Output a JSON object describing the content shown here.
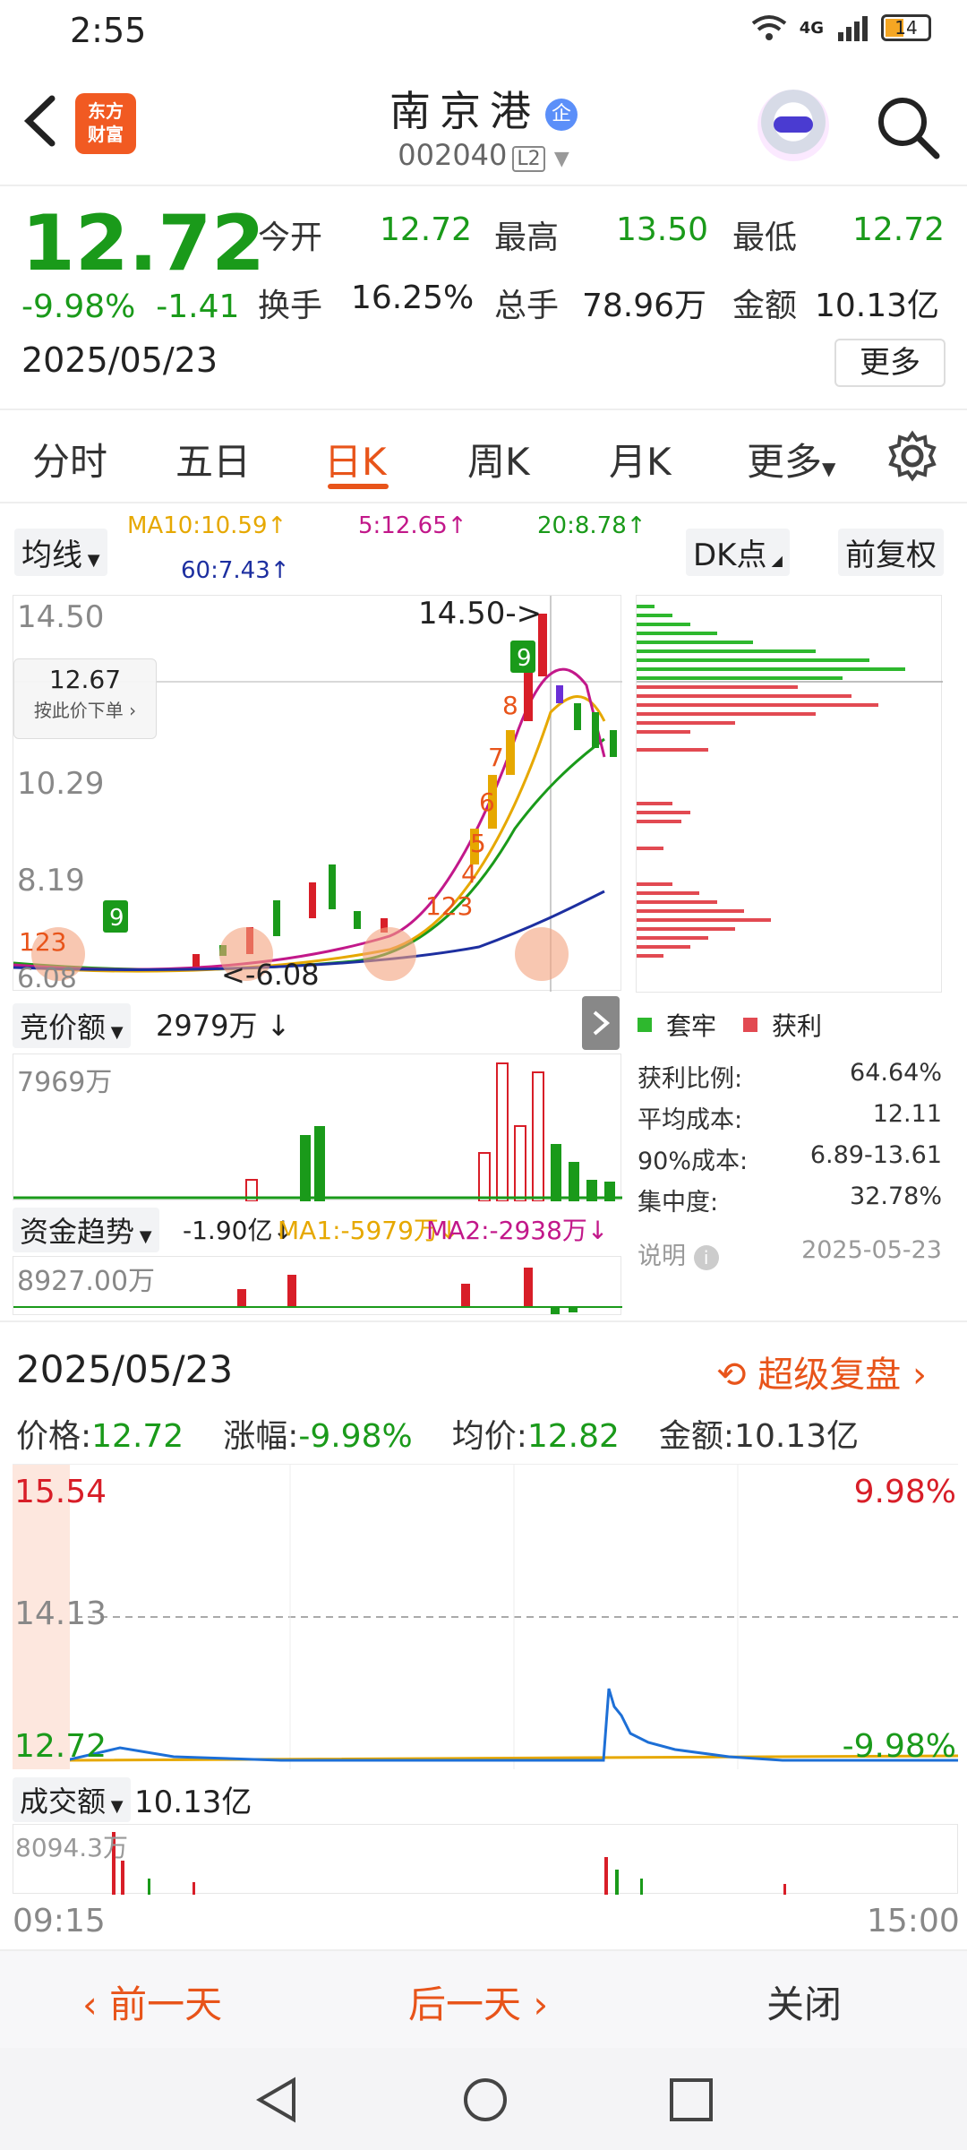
{
  "status": {
    "time": "2:55",
    "network": "4G",
    "battery": "14"
  },
  "header": {
    "logo_line1": "东方",
    "logo_line2": "财富",
    "title": "南京港",
    "badge": "企",
    "code": "002040",
    "level": "L2"
  },
  "quote": {
    "price": "12.72",
    "pct": "-9.98%",
    "change": "-1.41",
    "date": "2025/05/23",
    "open_label": "今开",
    "open": "12.72",
    "high_label": "最高",
    "high": "13.50",
    "low_label": "最低",
    "low": "12.72",
    "turnover_label": "换手",
    "turnover": "16.25%",
    "volume_label": "总手",
    "volume": "78.96万",
    "amount_label": "金额",
    "amount": "10.13亿",
    "more": "更多"
  },
  "tabs": [
    "分时",
    "五日",
    "日K",
    "周K",
    "月K",
    "更多"
  ],
  "active_tab": "日K",
  "kline": {
    "ma_button": "均线",
    "ma10": "MA10:10.59↑",
    "ma5": "5:12.65↑",
    "ma20": "20:8.78↑",
    "ma60": "60:7.43↑",
    "dk_button": "DK点",
    "fq_button": "前复权",
    "y_labels": [
      "14.50",
      "10.29",
      "8.19",
      "6.08"
    ],
    "max_marker": "14.50->",
    "min_marker": "<-6.08",
    "cursor_price": "12.67",
    "cursor_hint": "按此价下单",
    "auction_label": "竞价额",
    "auction_value": "2979万 ↓",
    "auction_max": "7969万",
    "fund_label": "资金趋势",
    "fund_value": "-1.90亿↓",
    "fund_ma1": "MA1:-5979万↓",
    "fund_ma2": "MA2:-2938万↓",
    "fund_max": "8927.00万"
  },
  "chip": {
    "legend_trapped": "套牢",
    "legend_profit": "获利",
    "stats": [
      {
        "label": "获利比例:",
        "value": "64.64%"
      },
      {
        "label": "平均成本:",
        "value": "12.11"
      },
      {
        "label": "90%成本:",
        "value": "6.89-13.61"
      },
      {
        "label": "集中度:",
        "value": "32.78%"
      }
    ],
    "note": "说明",
    "date": "2025-05-23"
  },
  "replay": {
    "date": "2025/05/23",
    "link": "超级复盘",
    "price_label": "价格:",
    "price": "12.72",
    "pct_label": "涨幅:",
    "pct": "-9.98%",
    "avg_label": "均价:",
    "avg": "12.82",
    "amt_label": "金额:",
    "amt": "10.13亿",
    "y_top": "15.54",
    "y_mid": "14.13",
    "y_bot": "12.72",
    "pct_top": "9.98%",
    "pct_bot": "-9.98%",
    "vol_label": "成交额",
    "vol_value": "10.13亿",
    "vol_max": "8094.3万",
    "t_start": "09:15",
    "t_end": "15:00"
  },
  "footer": {
    "prev": "前一天",
    "next": "后一天",
    "close": "关闭"
  },
  "colors": {
    "up": "#d81e28",
    "down": "#1a9a1a",
    "accent": "#e8541a",
    "ma5": "#c2188a",
    "ma10": "#e6a800",
    "ma20": "#1a9a1a",
    "ma60": "#1d2fa0"
  }
}
